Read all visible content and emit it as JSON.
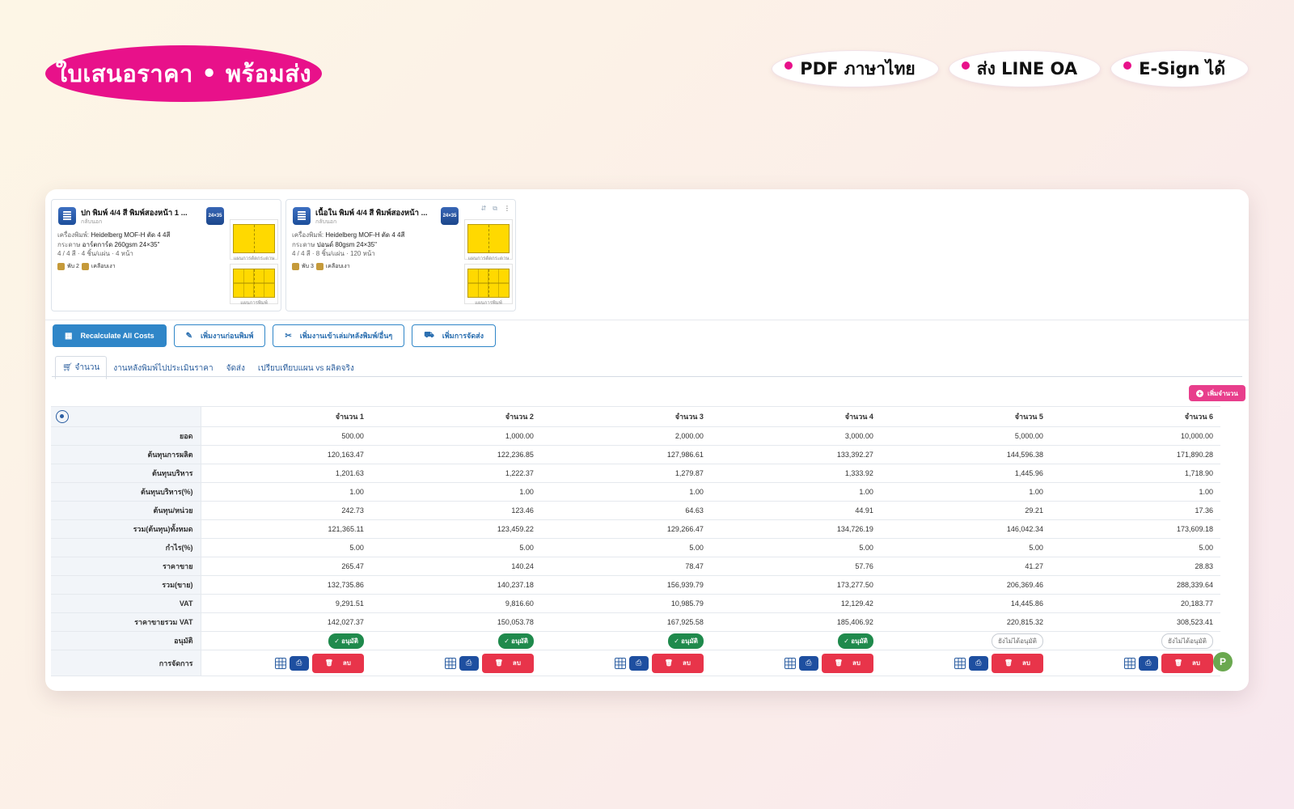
{
  "hero": {
    "title": "ใบเสนอราคา • พร้อมส่ง"
  },
  "features": [
    {
      "label": "PDF ภาษาไทย"
    },
    {
      "label": "ส่ง LINE OA"
    },
    {
      "label": "E-Sign ได้"
    }
  ],
  "cards": [
    {
      "title": "ปก พิมพ์ 4/4 สี พิมพ์สองหน้า 1 ...",
      "subtitle": "กลับนอก",
      "size_badge": "24×35",
      "printer_label": "เครื่องพิมพ์:",
      "printer": "Heidelberg MOF-H ตัด 4 4สี",
      "paper_label": "กระดาษ",
      "paper": "อาร์ตการ์ด 260gsm 24×35\"",
      "spec": "4 / 4 สี · 4 ชิ้น/แผ่น · 4 หน้า",
      "tag1": "พับ 2",
      "tag2": "เคลือบเงา",
      "thumb1_caption": "แผนการตัดกระดาษ",
      "thumb2_caption": "แผนการพิมพ์"
    },
    {
      "title": "เนื้อใน พิมพ์ 4/4 สี พิมพ์สองหน้า ...",
      "subtitle": "กลับนอก",
      "size_badge": "24×35",
      "printer_label": "เครื่องพิมพ์:",
      "printer": "Heidelberg MOF-H ตัด 4 4สี",
      "paper_label": "กระดาษ",
      "paper": "ปอนด์ 80gsm 24×35\"",
      "spec": "4 / 4 สี · 8 ชิ้น/แผ่น · 120 หน้า",
      "tag1": "พับ 3",
      "tag2": "เคลือบเงา",
      "thumb1_caption": "แผนการตัดกระดาษ",
      "thumb2_caption": "แผนการพิมพ์"
    }
  ],
  "toolbar": {
    "recalc": "Recalculate All Costs",
    "pre_press": "เพิ่มงานก่อนพิมพ์",
    "post_press": "เพิ่มงานเข้าเล่ม/หลังพิมพ์/อื่นๆ",
    "shipping": "เพิ่มการจัดส่ง"
  },
  "tabs": [
    {
      "label": "จำนวน",
      "active": true
    },
    {
      "label": "งานหลังพิมพ์ไปประเมินราคา",
      "active": false
    },
    {
      "label": "จัดส่ง",
      "active": false
    },
    {
      "label": "เปรียบเทียบแผน vs ผลิตจริง",
      "active": false
    }
  ],
  "add_quantity_label": "เพิ่มจำนวน",
  "table": {
    "columns": [
      "จำนวน 1",
      "จำนวน 2",
      "จำนวน 3",
      "จำนวน 4",
      "จำนวน 5",
      "จำนวน 6"
    ],
    "rows": [
      {
        "label": "ยอด",
        "values": [
          "500.00",
          "1,000.00",
          "2,000.00",
          "3,000.00",
          "5,000.00",
          "10,000.00"
        ]
      },
      {
        "label": "ต้นทุนการผลิต",
        "values": [
          "120,163.47",
          "122,236.85",
          "127,986.61",
          "133,392.27",
          "144,596.38",
          "171,890.28"
        ]
      },
      {
        "label": "ต้นทุนบริหาร",
        "values": [
          "1,201.63",
          "1,222.37",
          "1,279.87",
          "1,333.92",
          "1,445.96",
          "1,718.90"
        ]
      },
      {
        "label": "ต้นทุนบริหาร(%)",
        "values": [
          "1.00",
          "1.00",
          "1.00",
          "1.00",
          "1.00",
          "1.00"
        ]
      },
      {
        "label": "ต้นทุน/หน่วย",
        "values": [
          "242.73",
          "123.46",
          "64.63",
          "44.91",
          "29.21",
          "17.36"
        ]
      },
      {
        "label": "รวม(ต้นทุน)ทั้งหมด",
        "values": [
          "121,365.11",
          "123,459.22",
          "129,266.47",
          "134,726.19",
          "146,042.34",
          "173,609.18"
        ]
      },
      {
        "label": "กำไร(%)",
        "values": [
          "5.00",
          "5.00",
          "5.00",
          "5.00",
          "5.00",
          "5.00"
        ]
      },
      {
        "label": "ราคาขาย",
        "values": [
          "265.47",
          "140.24",
          "78.47",
          "57.76",
          "41.27",
          "28.83"
        ]
      },
      {
        "label": "รวม(ขาย)",
        "values": [
          "132,735.86",
          "140,237.18",
          "156,939.79",
          "173,277.50",
          "206,369.46",
          "288,339.64"
        ]
      },
      {
        "label": "VAT",
        "values": [
          "9,291.51",
          "9,816.60",
          "10,985.79",
          "12,129.42",
          "14,445.86",
          "20,183.77"
        ]
      },
      {
        "label": "ราคาขายรวม VAT",
        "values": [
          "142,027.37",
          "150,053.78",
          "167,925.58",
          "185,406.92",
          "220,815.32",
          "308,523.41"
        ]
      }
    ],
    "approve_label": "อนุมัติ",
    "approval": [
      "✓ อนุมัติ",
      "✓ อนุมัติ",
      "✓ อนุมัติ",
      "✓ อนุมัติ",
      "ยังไม่ได้อนุมัติ",
      "ยังไม่ได้อนุมัติ"
    ],
    "approved": [
      true,
      true,
      true,
      true,
      false,
      false
    ],
    "actions_label": "การจัดการ",
    "delete_label": "ลบ"
  },
  "avatar_initial": "P"
}
